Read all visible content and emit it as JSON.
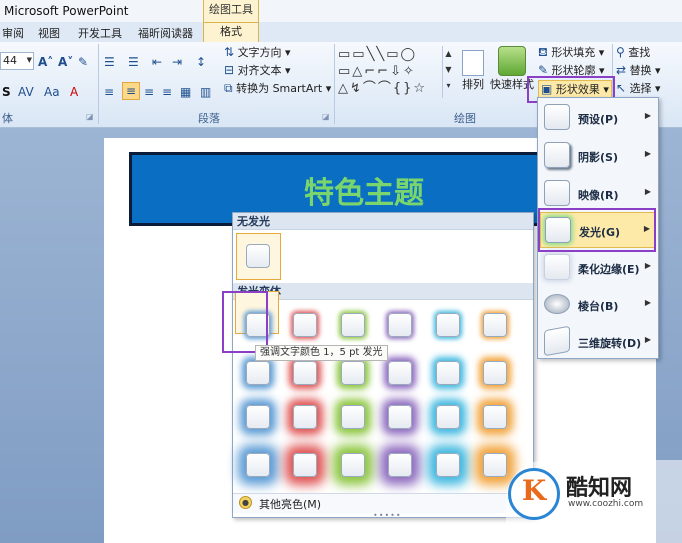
{
  "window": {
    "title": "Microsoft PowerPoint",
    "context_tab_group": "绘图工具"
  },
  "tabs": [
    {
      "label": "审阅"
    },
    {
      "label": "视图"
    },
    {
      "label": "开发工具"
    },
    {
      "label": "福昕阅读器"
    },
    {
      "label": "格式"
    }
  ],
  "ribbon": {
    "font_size": "44",
    "font_group_label": "体",
    "paragraph": {
      "label": "段落",
      "text_direction": "文字方向",
      "align_text": "对齐文本",
      "convert_smartart": "转换为 SmartArt"
    },
    "drawing": {
      "label": "绘图",
      "arrange": "排列",
      "quick_styles": "快速样式",
      "shape_fill": "形状填充",
      "shape_outline": "形状轮廓",
      "shape_effects": "形状效果"
    },
    "editing": {
      "find": "查找",
      "replace": "替换",
      "select": "选择"
    }
  },
  "slide": {
    "title": "特色主题"
  },
  "glow_gallery": {
    "no_glow_header": "无发光",
    "variations_header": "发光变体",
    "tooltip": "强调文字颜色 1，5 pt 发光",
    "more_colors": "其他亮色(M)",
    "colors": [
      "#5b9bd5",
      "#e05555",
      "#8cc63f",
      "#8e6bbf",
      "#3fb8e0",
      "#f2a33a"
    ],
    "rows": 4
  },
  "effects_menu": {
    "items": [
      {
        "label": "预设(P)"
      },
      {
        "label": "阴影(S)"
      },
      {
        "label": "映像(R)"
      },
      {
        "label": "发光(G)"
      },
      {
        "label": "柔化边缘(E)"
      },
      {
        "label": "棱台(B)"
      },
      {
        "label": "三维旋转(D)"
      }
    ]
  },
  "watermark": {
    "letter": "K",
    "name": "酷知网",
    "url": "www.coozhi.com"
  },
  "colors": {
    "highlight": "#8b3fc7",
    "title_fill": "#0a6fc2",
    "title_text": "#7ad66c"
  }
}
